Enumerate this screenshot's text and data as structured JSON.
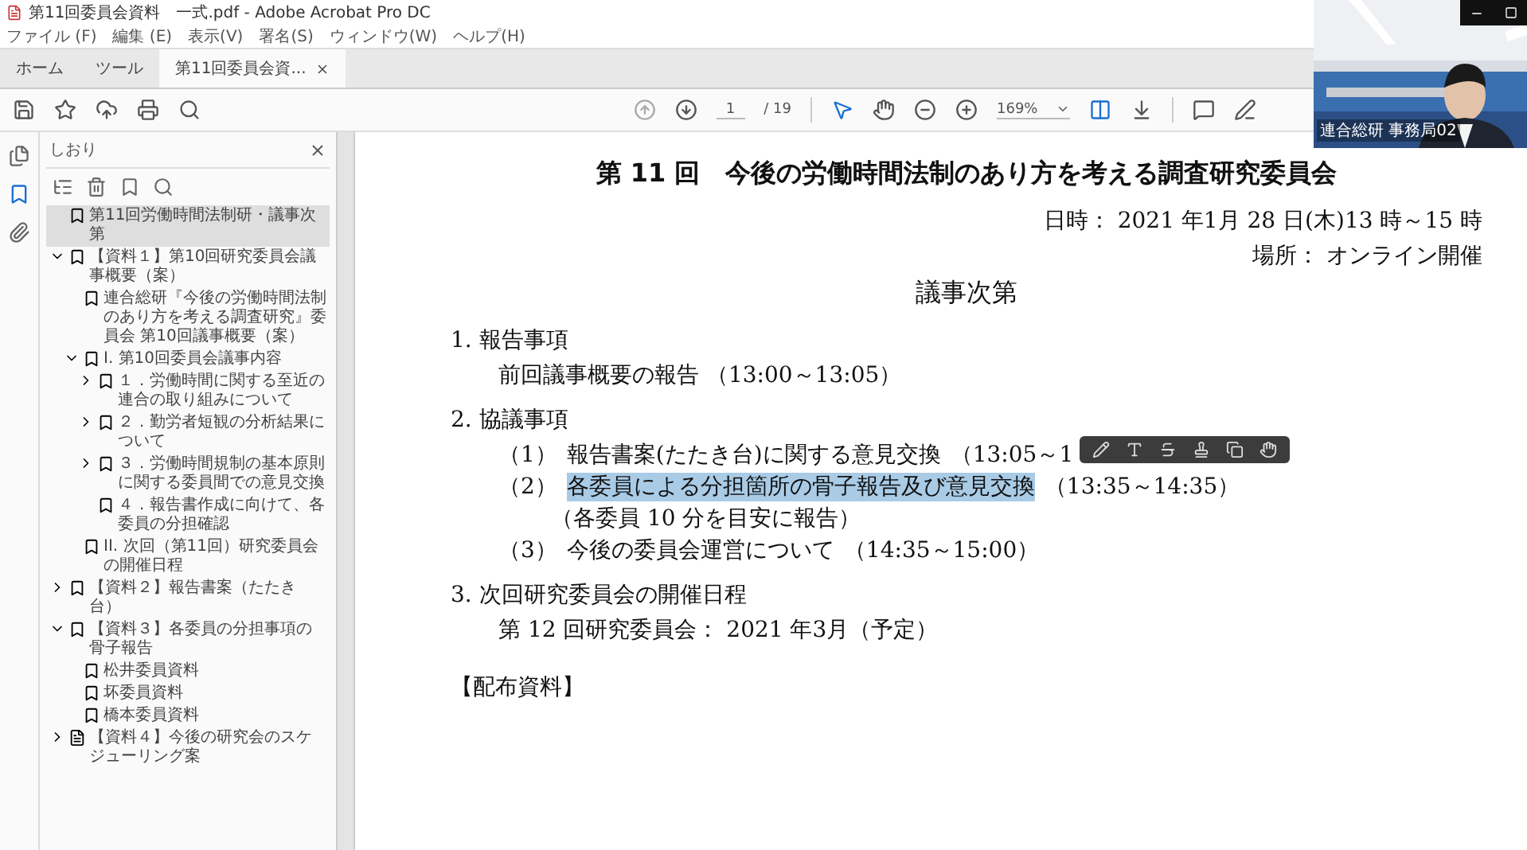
{
  "title_bar": {
    "title": "第11回委員会資料　一式.pdf - Adobe Acrobat Pro DC"
  },
  "menu": [
    "ファイル (F)",
    "編集 (E)",
    "表示(V)",
    "署名(S)",
    "ウィンドウ(W)",
    "ヘルプ(H)"
  ],
  "tabs": [
    {
      "label": "ホーム",
      "selected": false,
      "kind": "nav"
    },
    {
      "label": "ツール",
      "selected": false,
      "kind": "nav"
    },
    {
      "label": "第11回委員会資...",
      "selected": true,
      "kind": "document"
    }
  ],
  "toolbar": {
    "page": "1",
    "page_total": "/ 19",
    "zoom": "169%"
  },
  "sidebar": {
    "title": "しおり",
    "bookmarks": [
      {
        "label": "第11回労働時間法制研・議事次第",
        "selected": true
      },
      {
        "label": "【資料１】第10回研究委員会議事概要（案）",
        "selected": false,
        "expanded": true,
        "children": [
          {
            "label": "連合総研『今後の労働時間法制のあり方を考える調査研究』委員会 第10回議事概要（案）",
            "selected": false
          },
          {
            "label": "I. 第10回委員会議事内容",
            "selected": false,
            "expanded": true,
            "children": [
              {
                "label": "１．労働時間に関する至近の連合の取り組みについて",
                "selected": false,
                "expanded": false
              },
              {
                "label": "２．勤労者短観の分析結果について",
                "selected": false,
                "expanded": false
              },
              {
                "label": "３．労働時間規制の基本原則に関する委員間での意見交換",
                "selected": false,
                "expanded": false
              },
              {
                "label": "４．報告書作成に向けて、各委員の分担確認",
                "selected": false
              }
            ]
          },
          {
            "label": "II. 次回（第11回）研究委員会の開催日程",
            "selected": false
          }
        ]
      },
      {
        "label": "【資料２】報告書案（たたき台）",
        "selected": false,
        "expanded": false
      },
      {
        "label": "【資料３】各委員の分担事項の骨子報告",
        "selected": false,
        "expanded": true,
        "children": [
          {
            "label": "松井委員資料",
            "selected": false
          },
          {
            "label": "坏委員資料",
            "selected": false
          },
          {
            "label": "橋本委員資料",
            "selected": false
          }
        ]
      },
      {
        "label": "【資料４】今後の研究会のスケジューリング案",
        "selected": false,
        "expanded": false,
        "kind": "page"
      }
    ]
  },
  "document": {
    "heading": "第 11 回　今後の労働時間法制のあり方を考える調査研究委員会",
    "date_line": "日時： 2021 年1月 28 日(木)13 時～15 時",
    "place_line": "場所： オンライン開催",
    "subheading": "議事次第",
    "sections": [
      {
        "number": "1.",
        "title": "報告事項",
        "items": [
          {
            "text": "前回議事概要の報告 （13:00～13:05）",
            "highlighted": false
          }
        ]
      },
      {
        "number": "2.",
        "title": "協議事項",
        "items": [
          {
            "label": "（1）",
            "text": "報告書案(たたき台)に関する意見交換",
            "time": "（13:05～1",
            "highlighted": false
          },
          {
            "label": "（2）",
            "text": "各委員による分担箇所の骨子報告及び意見交換",
            "time": "（13:35～14:35）",
            "note": "（各委員 10 分を目安に報告）",
            "highlighted": true
          },
          {
            "label": "（3）",
            "text": "今後の委員会運営について",
            "time": "（14:35～15:00）",
            "highlighted": false
          }
        ]
      },
      {
        "number": "3.",
        "title": "次回研究委員会の開催日程",
        "items": [
          {
            "text": "第 12 回研究委員会： 2021 年3月（予定）",
            "highlighted": false
          }
        ]
      }
    ],
    "footer_heading": "【配布資料】"
  },
  "video": {
    "name": "連合総研 事務局02"
  }
}
